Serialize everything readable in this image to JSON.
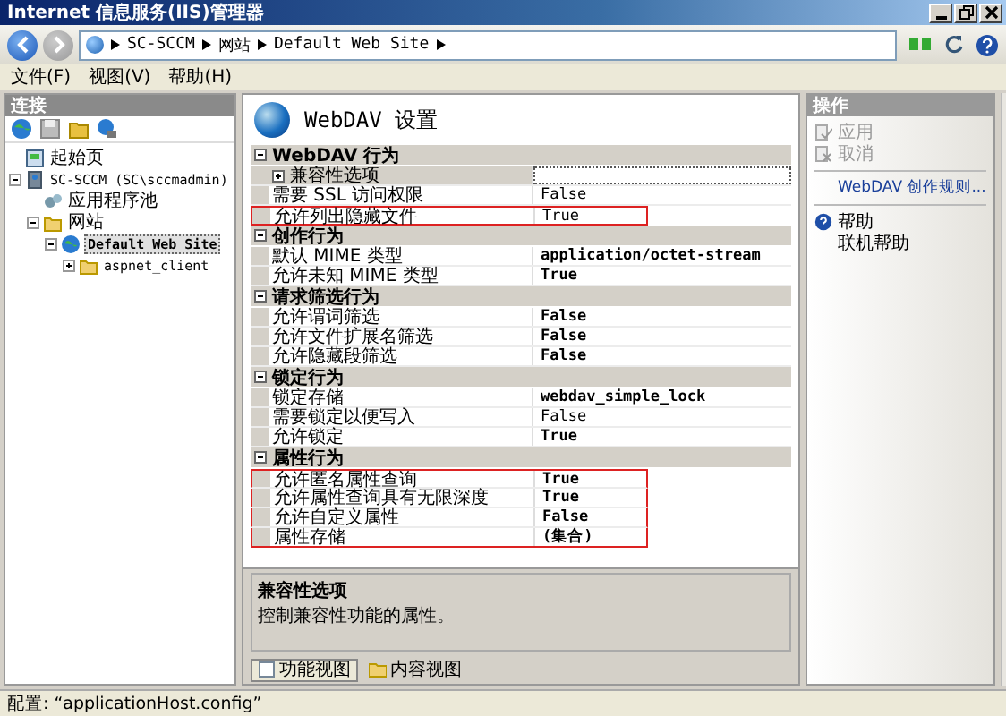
{
  "window": {
    "title": "Internet 信息服务(IIS)管理器"
  },
  "address": {
    "segments": [
      "SC-SCCM",
      "网站",
      "Default Web Site"
    ]
  },
  "menu": [
    "文件(F)",
    "视图(V)",
    "帮助(H)"
  ],
  "connections": {
    "title": "连接",
    "tree": [
      {
        "label": "起始页",
        "kind": "start",
        "selected": false
      },
      {
        "label": "SC-SCCM (SC\\sccmadmin)",
        "kind": "server",
        "selected": false,
        "expanded": true,
        "children": [
          {
            "label": "应用程序池",
            "kind": "pool",
            "selected": false
          },
          {
            "label": "网站",
            "kind": "folder",
            "selected": false,
            "expanded": true,
            "children": [
              {
                "label": "Default Web Site",
                "kind": "site",
                "selected": true,
                "expanded": true,
                "children": [
                  {
                    "label": "aspnet_client",
                    "kind": "folder",
                    "selected": false,
                    "expanded": false
                  }
                ]
              }
            ]
          }
        ]
      }
    ]
  },
  "feature": {
    "title": "WebDAV 设置",
    "sections": [
      {
        "title": "WebDAV 行为",
        "expanded": true,
        "rows": [
          {
            "kind": "group",
            "name": "兼容性选项",
            "expanded": false,
            "selected": true
          },
          {
            "kind": "property",
            "name": "需要 SSL 访问权限",
            "value": "False",
            "bold": false,
            "highlighted": false,
            "selected": false
          },
          {
            "kind": "property",
            "name": "允许列出隐藏文件",
            "value": "True",
            "bold": false,
            "highlighted": true,
            "selected": false
          }
        ]
      },
      {
        "title": "创作行为",
        "expanded": true,
        "rows": [
          {
            "kind": "property",
            "name": "默认 MIME 类型",
            "value": "application/octet-stream",
            "bold": true,
            "highlighted": false,
            "selected": false
          },
          {
            "kind": "property",
            "name": "允许未知 MIME 类型",
            "value": "True",
            "bold": true,
            "highlighted": false,
            "selected": false
          }
        ]
      },
      {
        "title": "请求筛选行为",
        "expanded": true,
        "rows": [
          {
            "kind": "property",
            "name": "允许谓词筛选",
            "value": "False",
            "bold": true,
            "highlighted": false,
            "selected": false
          },
          {
            "kind": "property",
            "name": "允许文件扩展名筛选",
            "value": "False",
            "bold": true,
            "highlighted": false,
            "selected": false
          },
          {
            "kind": "property",
            "name": "允许隐藏段筛选",
            "value": "False",
            "bold": true,
            "highlighted": false,
            "selected": false
          }
        ]
      },
      {
        "title": "锁定行为",
        "expanded": true,
        "rows": [
          {
            "kind": "property",
            "name": "锁定存储",
            "value": "webdav_simple_lock",
            "bold": true,
            "highlighted": false,
            "selected": false
          },
          {
            "kind": "property",
            "name": "需要锁定以便写入",
            "value": "False",
            "bold": false,
            "highlighted": false,
            "selected": false
          },
          {
            "kind": "property",
            "name": "允许锁定",
            "value": "True",
            "bold": true,
            "highlighted": false,
            "selected": false
          }
        ]
      },
      {
        "title": "属性行为",
        "expanded": true,
        "rows": [
          {
            "kind": "property",
            "name": "允许匿名属性查询",
            "value": "True",
            "bold": true,
            "highlighted": true,
            "selected": false
          },
          {
            "kind": "property",
            "name": "允许属性查询具有无限深度",
            "value": "True",
            "bold": true,
            "highlighted": true,
            "selected": false
          },
          {
            "kind": "property",
            "name": "允许自定义属性",
            "value": "False",
            "bold": true,
            "highlighted": true,
            "selected": false
          },
          {
            "kind": "property",
            "name": "属性存储",
            "value": "(集合)",
            "bold": true,
            "highlighted": true,
            "selected": false
          }
        ]
      }
    ],
    "description": {
      "title": "兼容性选项",
      "text": "控制兼容性功能的属性。"
    },
    "views": [
      {
        "label": "功能视图",
        "selected": true
      },
      {
        "label": "内容视图",
        "selected": false
      }
    ]
  },
  "actions": {
    "title": "操作",
    "items": [
      {
        "kind": "apply",
        "label": "应用",
        "disabled": true
      },
      {
        "kind": "cancel",
        "label": "取消",
        "disabled": true
      },
      {
        "kind": "separator"
      },
      {
        "kind": "link",
        "label": "WebDAV 创作规则...",
        "disabled": false
      },
      {
        "kind": "separator"
      },
      {
        "kind": "help",
        "label": "帮助",
        "disabled": false
      },
      {
        "kind": "plain",
        "label": "联机帮助",
        "disabled": false
      }
    ]
  },
  "status_bar": {
    "text": "配置: “applicationHost.config”"
  }
}
